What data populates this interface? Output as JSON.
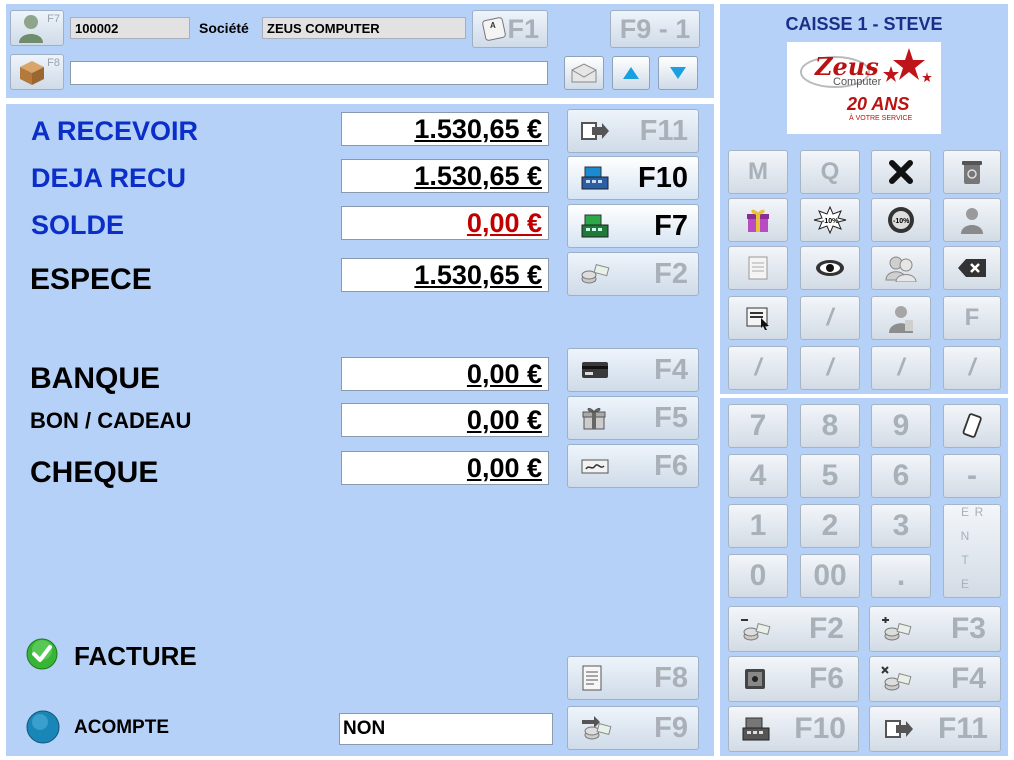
{
  "header": {
    "f7_key": "F7",
    "f8_key": "F8",
    "client_code": "100002",
    "societe_label": "Société",
    "societe_value": "ZEUS COMPUTER",
    "f1_label": "F1",
    "f9_label": "F9 - 1",
    "search_value": ""
  },
  "caisse": {
    "title": "CAISSE 1 - STEVE",
    "logo_brand": "Zeus",
    "logo_sub": "Computer",
    "logo_years": "20 ANS",
    "logo_tagline": "À VOTRE SERVICE"
  },
  "payment": {
    "rows": [
      {
        "label": "A RECEVOIR",
        "amount": "1.530,65 €",
        "key": "F11"
      },
      {
        "label": "DEJA RECU",
        "amount": "1.530,65 €",
        "key": "F10"
      },
      {
        "label": "SOLDE",
        "amount": "0,00 €",
        "key": "F7"
      },
      {
        "label": "ESPECE",
        "amount": "1.530,65 €",
        "key": "F2"
      },
      {
        "label": "BANQUE",
        "amount": "0,00 €",
        "key": "F4"
      },
      {
        "label": "BON / CADEAU",
        "amount": "0,00 €",
        "key": "F5"
      },
      {
        "label": "CHEQUE",
        "amount": "0,00 €",
        "key": "F6"
      }
    ],
    "facture_label": "FACTURE",
    "facture_key": "F8",
    "acompte_label": "ACOMPTE",
    "acompte_value": "NON",
    "acompte_key": "F9"
  },
  "keypad": {
    "func_row1": [
      "M",
      "Q"
    ],
    "func_f": "F",
    "slash": "/",
    "digits": [
      "7",
      "8",
      "9",
      "4",
      "5",
      "6",
      "1",
      "2",
      "3",
      "0",
      "00",
      "."
    ],
    "minus": "-",
    "enter": "E N T E R",
    "bottom_keys": [
      "F2",
      "F3",
      "F6",
      "F4",
      "F10",
      "F11"
    ]
  },
  "colors": {
    "panel_bg": "#b5d1f7",
    "label_blue": "#0a2ec7",
    "solde_red": "#c00000",
    "caisse_title": "#1b2f8a"
  }
}
